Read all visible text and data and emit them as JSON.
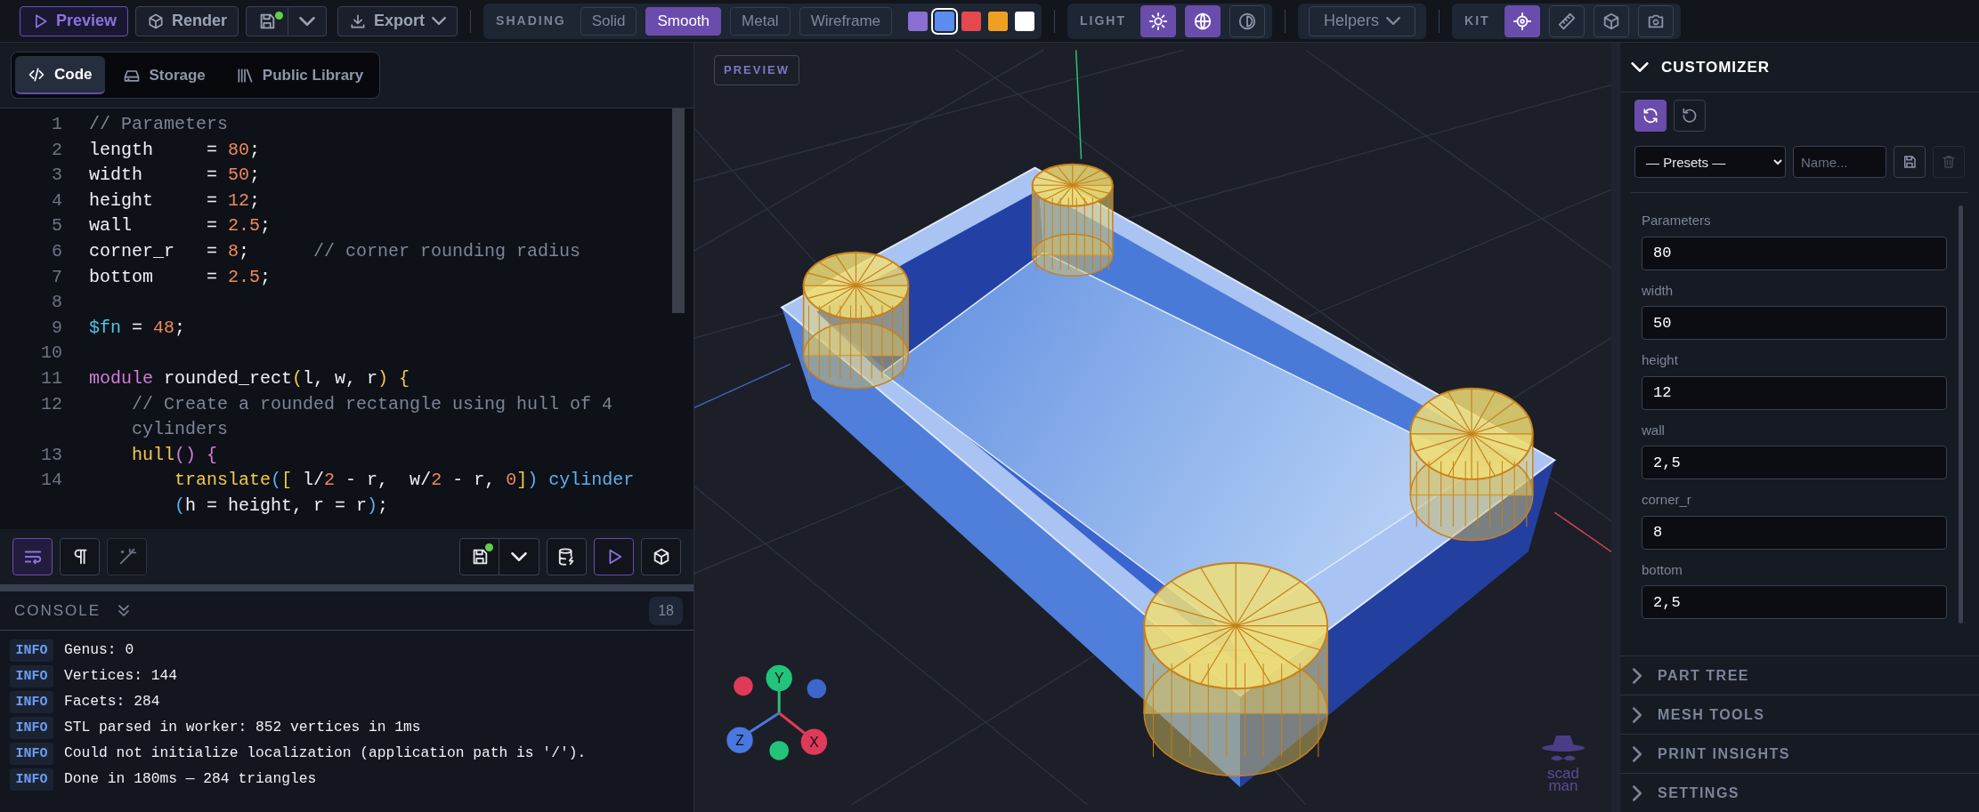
{
  "toolbar": {
    "actions": [
      {
        "kind": "preview",
        "label": "Preview"
      },
      {
        "kind": "render",
        "label": "Render"
      }
    ],
    "save": {
      "modified": true
    },
    "export": {
      "label": "Export"
    },
    "shading": {
      "label": "SHADING",
      "modes": [
        {
          "label": "Solid",
          "selected": false
        },
        {
          "label": "Smooth",
          "selected": true
        },
        {
          "label": "Metal",
          "selected": false
        },
        {
          "label": "Wireframe",
          "selected": false
        }
      ]
    },
    "colors": [
      {
        "color": "#8a6fd1",
        "selected": false
      },
      {
        "color": "#5b8def",
        "selected": true
      },
      {
        "color": "#e5484d",
        "selected": false
      },
      {
        "color": "#f0a020",
        "selected": false
      },
      {
        "color": "#ffffff",
        "selected": false
      }
    ],
    "light": {
      "label": "LIGHT",
      "toggles": [
        {
          "kind": "sun",
          "selected": true
        },
        {
          "kind": "globe",
          "selected": true
        },
        {
          "kind": "contrast",
          "selected": false
        }
      ]
    },
    "helpers": {
      "label": "Helpers"
    },
    "kit": {
      "label": "KIT",
      "tools": [
        {
          "kind": "target",
          "selected": true
        },
        {
          "kind": "ruler",
          "selected": false
        },
        {
          "kind": "box",
          "selected": false
        },
        {
          "kind": "camera",
          "selected": false
        }
      ]
    }
  },
  "editor_tabs": [
    {
      "kind": "code",
      "label": "Code",
      "selected": true
    },
    {
      "kind": "storage",
      "label": "Storage",
      "selected": false
    },
    {
      "kind": "library",
      "label": "Public Library",
      "selected": false
    }
  ],
  "code_lines": [
    {
      "number": "1",
      "rows": [
        [
          {
            "kind": "comment",
            "text": "// Parameters"
          }
        ]
      ]
    },
    {
      "number": "2",
      "rows": [
        [
          {
            "kind": "ident",
            "text": "length"
          },
          {
            "kind": "op",
            "text": "     = "
          },
          {
            "kind": "num",
            "text": "80"
          },
          {
            "kind": "op",
            "text": ";"
          }
        ]
      ]
    },
    {
      "number": "3",
      "rows": [
        [
          {
            "kind": "ident",
            "text": "width"
          },
          {
            "kind": "op",
            "text": "      = "
          },
          {
            "kind": "num",
            "text": "50"
          },
          {
            "kind": "op",
            "text": ";"
          }
        ]
      ]
    },
    {
      "number": "4",
      "rows": [
        [
          {
            "kind": "ident",
            "text": "height"
          },
          {
            "kind": "op",
            "text": "     = "
          },
          {
            "kind": "num",
            "text": "12"
          },
          {
            "kind": "op",
            "text": ";"
          }
        ]
      ]
    },
    {
      "number": "5",
      "rows": [
        [
          {
            "kind": "ident",
            "text": "wall"
          },
          {
            "kind": "op",
            "text": "       = "
          },
          {
            "kind": "num",
            "text": "2.5"
          },
          {
            "kind": "op",
            "text": ";"
          }
        ]
      ]
    },
    {
      "number": "6",
      "rows": [
        [
          {
            "kind": "ident",
            "text": "corner_r"
          },
          {
            "kind": "op",
            "text": "   = "
          },
          {
            "kind": "num",
            "text": "8"
          },
          {
            "kind": "op",
            "text": ";      "
          },
          {
            "kind": "comment",
            "text": "// corner rounding radius"
          }
        ]
      ]
    },
    {
      "number": "7",
      "rows": [
        [
          {
            "kind": "ident",
            "text": "bottom"
          },
          {
            "kind": "op",
            "text": "     = "
          },
          {
            "kind": "num",
            "text": "2.5"
          },
          {
            "kind": "op",
            "text": ";"
          }
        ]
      ]
    },
    {
      "number": "8",
      "rows": [
        []
      ]
    },
    {
      "number": "9",
      "rows": [
        [
          {
            "kind": "var",
            "text": "$fn"
          },
          {
            "kind": "op",
            "text": " = "
          },
          {
            "kind": "num",
            "text": "48"
          },
          {
            "kind": "op",
            "text": ";"
          }
        ]
      ]
    },
    {
      "number": "10",
      "rows": [
        []
      ]
    },
    {
      "number": "11",
      "rows": [
        [
          {
            "kind": "kw",
            "text": "module"
          },
          {
            "kind": "ident",
            "text": " rounded_rect"
          },
          {
            "kind": "b1",
            "text": "("
          },
          {
            "kind": "ident",
            "text": "l, w, r"
          },
          {
            "kind": "b1",
            "text": ") {"
          }
        ]
      ]
    },
    {
      "number": "12",
      "rows": [
        {
          "tokens": [
            {
              "kind": "comment",
              "text": "    // Create a rounded rectangle using hull of 4"
            }
          ]
        },
        {
          "tokens": [
            {
              "kind": "comment",
              "text": "    cylinders"
            }
          ]
        }
      ]
    },
    {
      "number": "13",
      "rows": [
        [
          {
            "kind": "fn",
            "text": "    hull"
          },
          {
            "kind": "b2",
            "text": "() {"
          }
        ]
      ]
    },
    {
      "number": "14",
      "rows": [
        {
          "tokens": [
            {
              "kind": "fn",
              "text": "        translate"
            },
            {
              "kind": "b3",
              "text": "("
            },
            {
              "kind": "b1",
              "text": "["
            },
            {
              "kind": "ident",
              "text": " l/"
            },
            {
              "kind": "num",
              "text": "2"
            },
            {
              "kind": "ident",
              "text": " - r,  w/"
            },
            {
              "kind": "num",
              "text": "2"
            },
            {
              "kind": "ident",
              "text": " - r, "
            },
            {
              "kind": "num",
              "text": "0"
            },
            {
              "kind": "b1",
              "text": "]"
            },
            {
              "kind": "b3",
              "text": ")"
            },
            {
              "kind": "builtin",
              "text": " cylinder"
            }
          ]
        },
        {
          "tokens": [
            {
              "kind": "b3",
              "text": "        ("
            },
            {
              "kind": "ident",
              "text": "h = height, r = r"
            },
            {
              "kind": "b3",
              "text": ")"
            },
            {
              "kind": "op",
              "text": ";"
            }
          ]
        }
      ]
    }
  ],
  "editor_tools": {
    "left": [
      {
        "kind": "wrap",
        "selected": true
      },
      {
        "kind": "pilcrow",
        "selected": false
      },
      {
        "kind": "wand",
        "selected": false
      }
    ],
    "save": {
      "modified": true
    }
  },
  "console": {
    "title": "CONSOLE",
    "count": "18",
    "entries": [
      {
        "level": "INFO",
        "text": "Genus: 0"
      },
      {
        "level": "INFO",
        "text": "Vertices: 144"
      },
      {
        "level": "INFO",
        "text": "Facets: 284"
      },
      {
        "level": "INFO",
        "text": "STL parsed in worker: 852 vertices in 1ms"
      },
      {
        "level": "INFO",
        "text": "Could not initialize localization (application path is '/')."
      },
      {
        "level": "INFO",
        "text": "Done in 180ms — 284 triangles"
      }
    ]
  },
  "viewport": {
    "badge": "PREVIEW",
    "gizmo_axes": [
      "Y",
      "Z",
      "X"
    ],
    "logo": [
      "scad",
      "man"
    ]
  },
  "customizer": {
    "title": "CUSTOMIZER",
    "expanded": true,
    "auto_refresh": {
      "selected": true
    },
    "presets": "— Presets —",
    "name_placeholder": "Name...",
    "delete_disabled": true,
    "params": [
      {
        "label": "Parameters",
        "value": "80"
      },
      {
        "label": "width",
        "value": "50"
      },
      {
        "label": "height",
        "value": "12"
      },
      {
        "label": "wall",
        "value": "2,5"
      },
      {
        "label": "corner_r",
        "value": "8"
      },
      {
        "label": "bottom",
        "value": "2,5"
      }
    ]
  },
  "sections": [
    {
      "label": "PART TREE",
      "expanded": false
    },
    {
      "label": "MESH TOOLS",
      "expanded": false
    },
    {
      "label": "PRINT INSIGHTS",
      "expanded": false
    },
    {
      "label": "SETTINGS",
      "expanded": false
    }
  ]
}
